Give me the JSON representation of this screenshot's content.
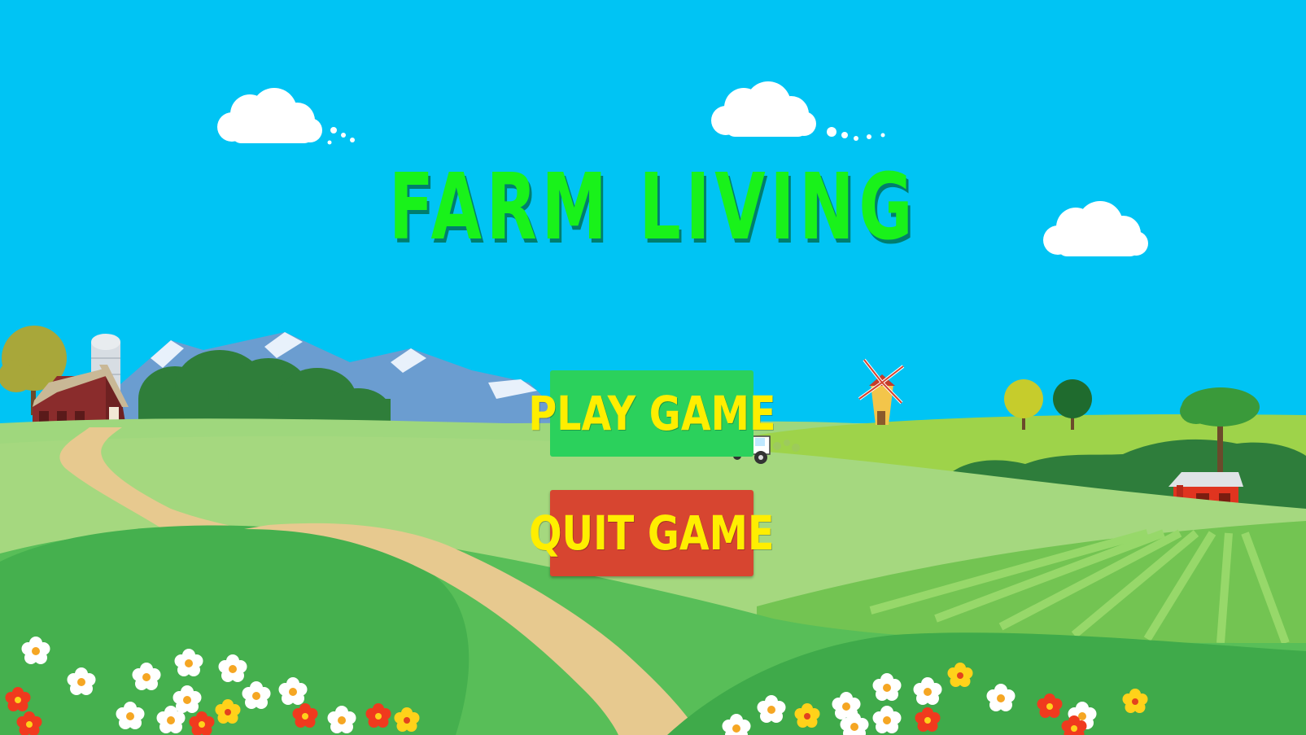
{
  "game": {
    "title": "FARM LIVING"
  },
  "menu": {
    "play_label": "PLAY GAME",
    "quit_label": "QUIT GAME"
  },
  "colors": {
    "sky": "#00c4f4",
    "title": "#19f21a",
    "button_text": "#ffee00",
    "play_button": "#2bd15c",
    "quit_button": "#d74530",
    "grass_light": "#9fd77d",
    "grass_mid": "#55be55",
    "grass_dark": "#3ba64a",
    "path": "#e7c98f"
  },
  "icons": [
    "cloud-icon",
    "barn-icon",
    "silo-icon",
    "windmill-icon",
    "tractor-icon",
    "tree-icon",
    "flower-icon"
  ]
}
